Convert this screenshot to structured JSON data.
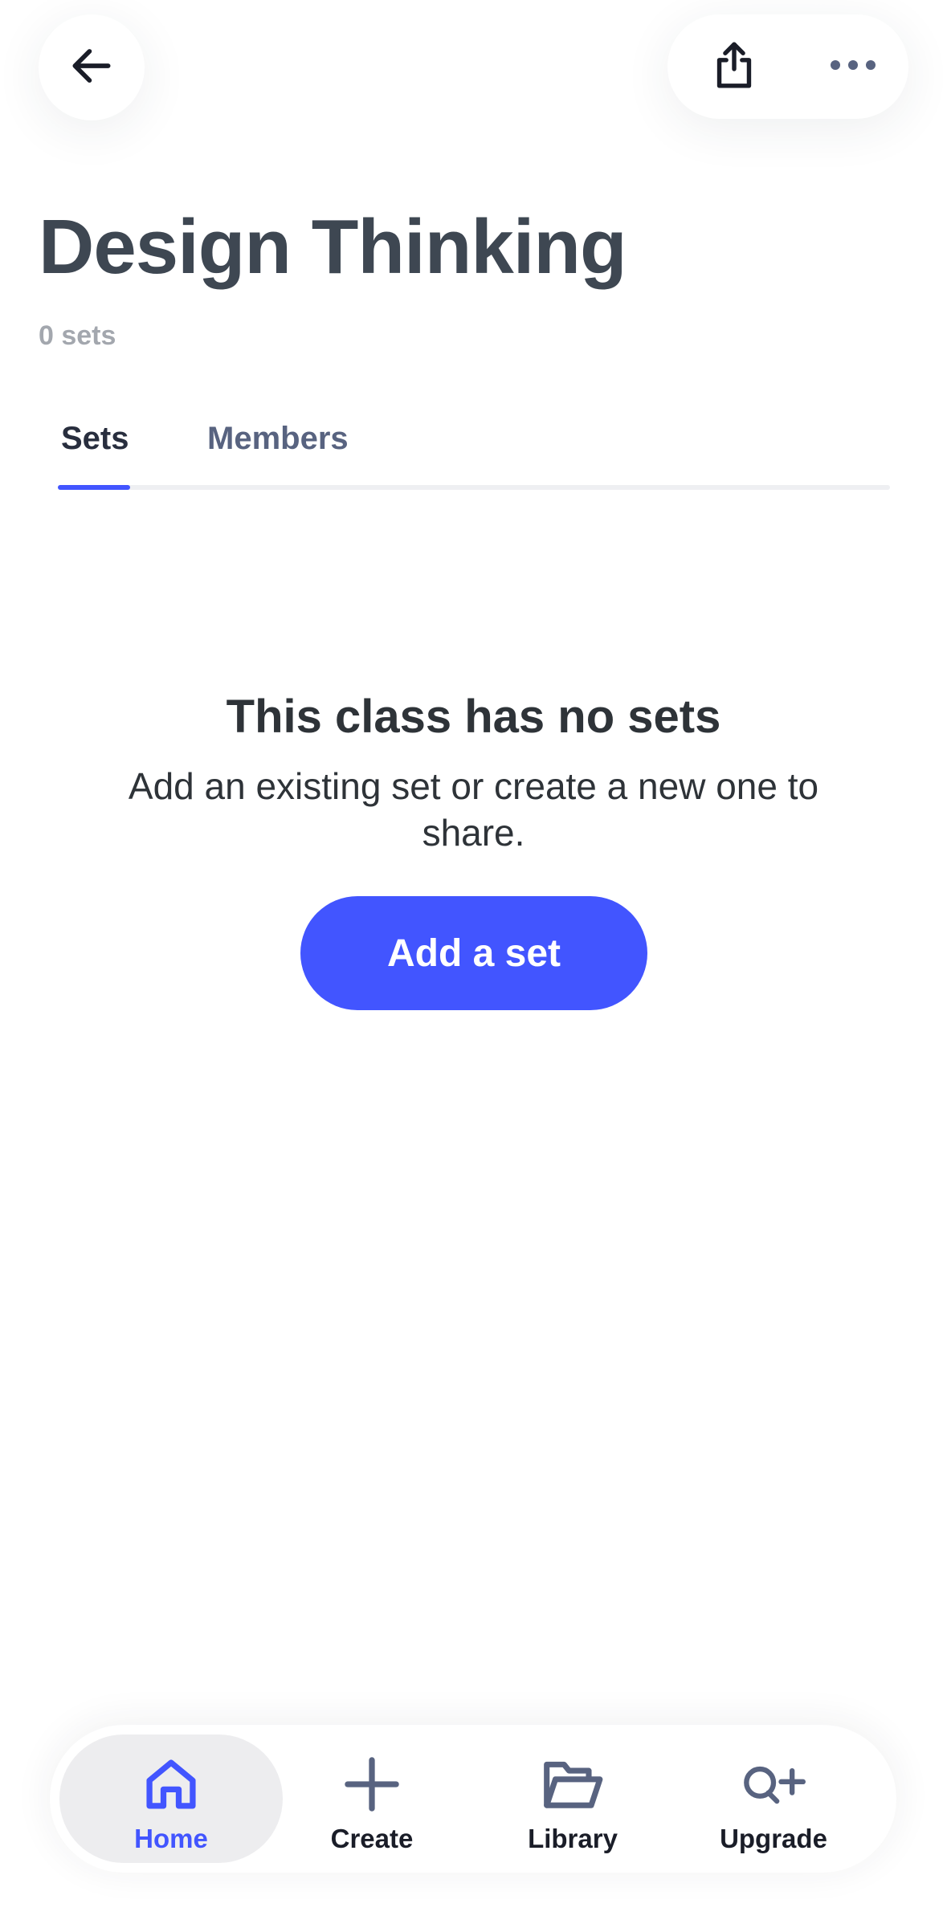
{
  "colors": {
    "accent": "#4255ff",
    "title_text": "#3e4752",
    "body_text": "#2e3338",
    "muted_text": "#a3a7ae",
    "inactive_tab": "#586380",
    "active_nav_bg": "#ededef"
  },
  "header": {
    "back_icon": "arrow-left-icon",
    "share_icon": "share-icon",
    "more_icon": "more-horizontal-icon"
  },
  "class": {
    "title": "Design Thinking",
    "set_count": "0 sets"
  },
  "tabs": [
    {
      "label": "Sets",
      "active": true
    },
    {
      "label": "Members",
      "active": false
    }
  ],
  "empty_state": {
    "title": "This class has no sets",
    "description": "Add an existing set or create a new one to share.",
    "button_label": "Add a set"
  },
  "bottom_nav": {
    "items": [
      {
        "label": "Home",
        "icon": "home-icon",
        "active": true
      },
      {
        "label": "Create",
        "icon": "plus-icon",
        "active": false
      },
      {
        "label": "Library",
        "icon": "folder-icon",
        "active": false
      },
      {
        "label": "Upgrade",
        "icon": "quizlet-plus-icon",
        "active": false
      }
    ]
  }
}
